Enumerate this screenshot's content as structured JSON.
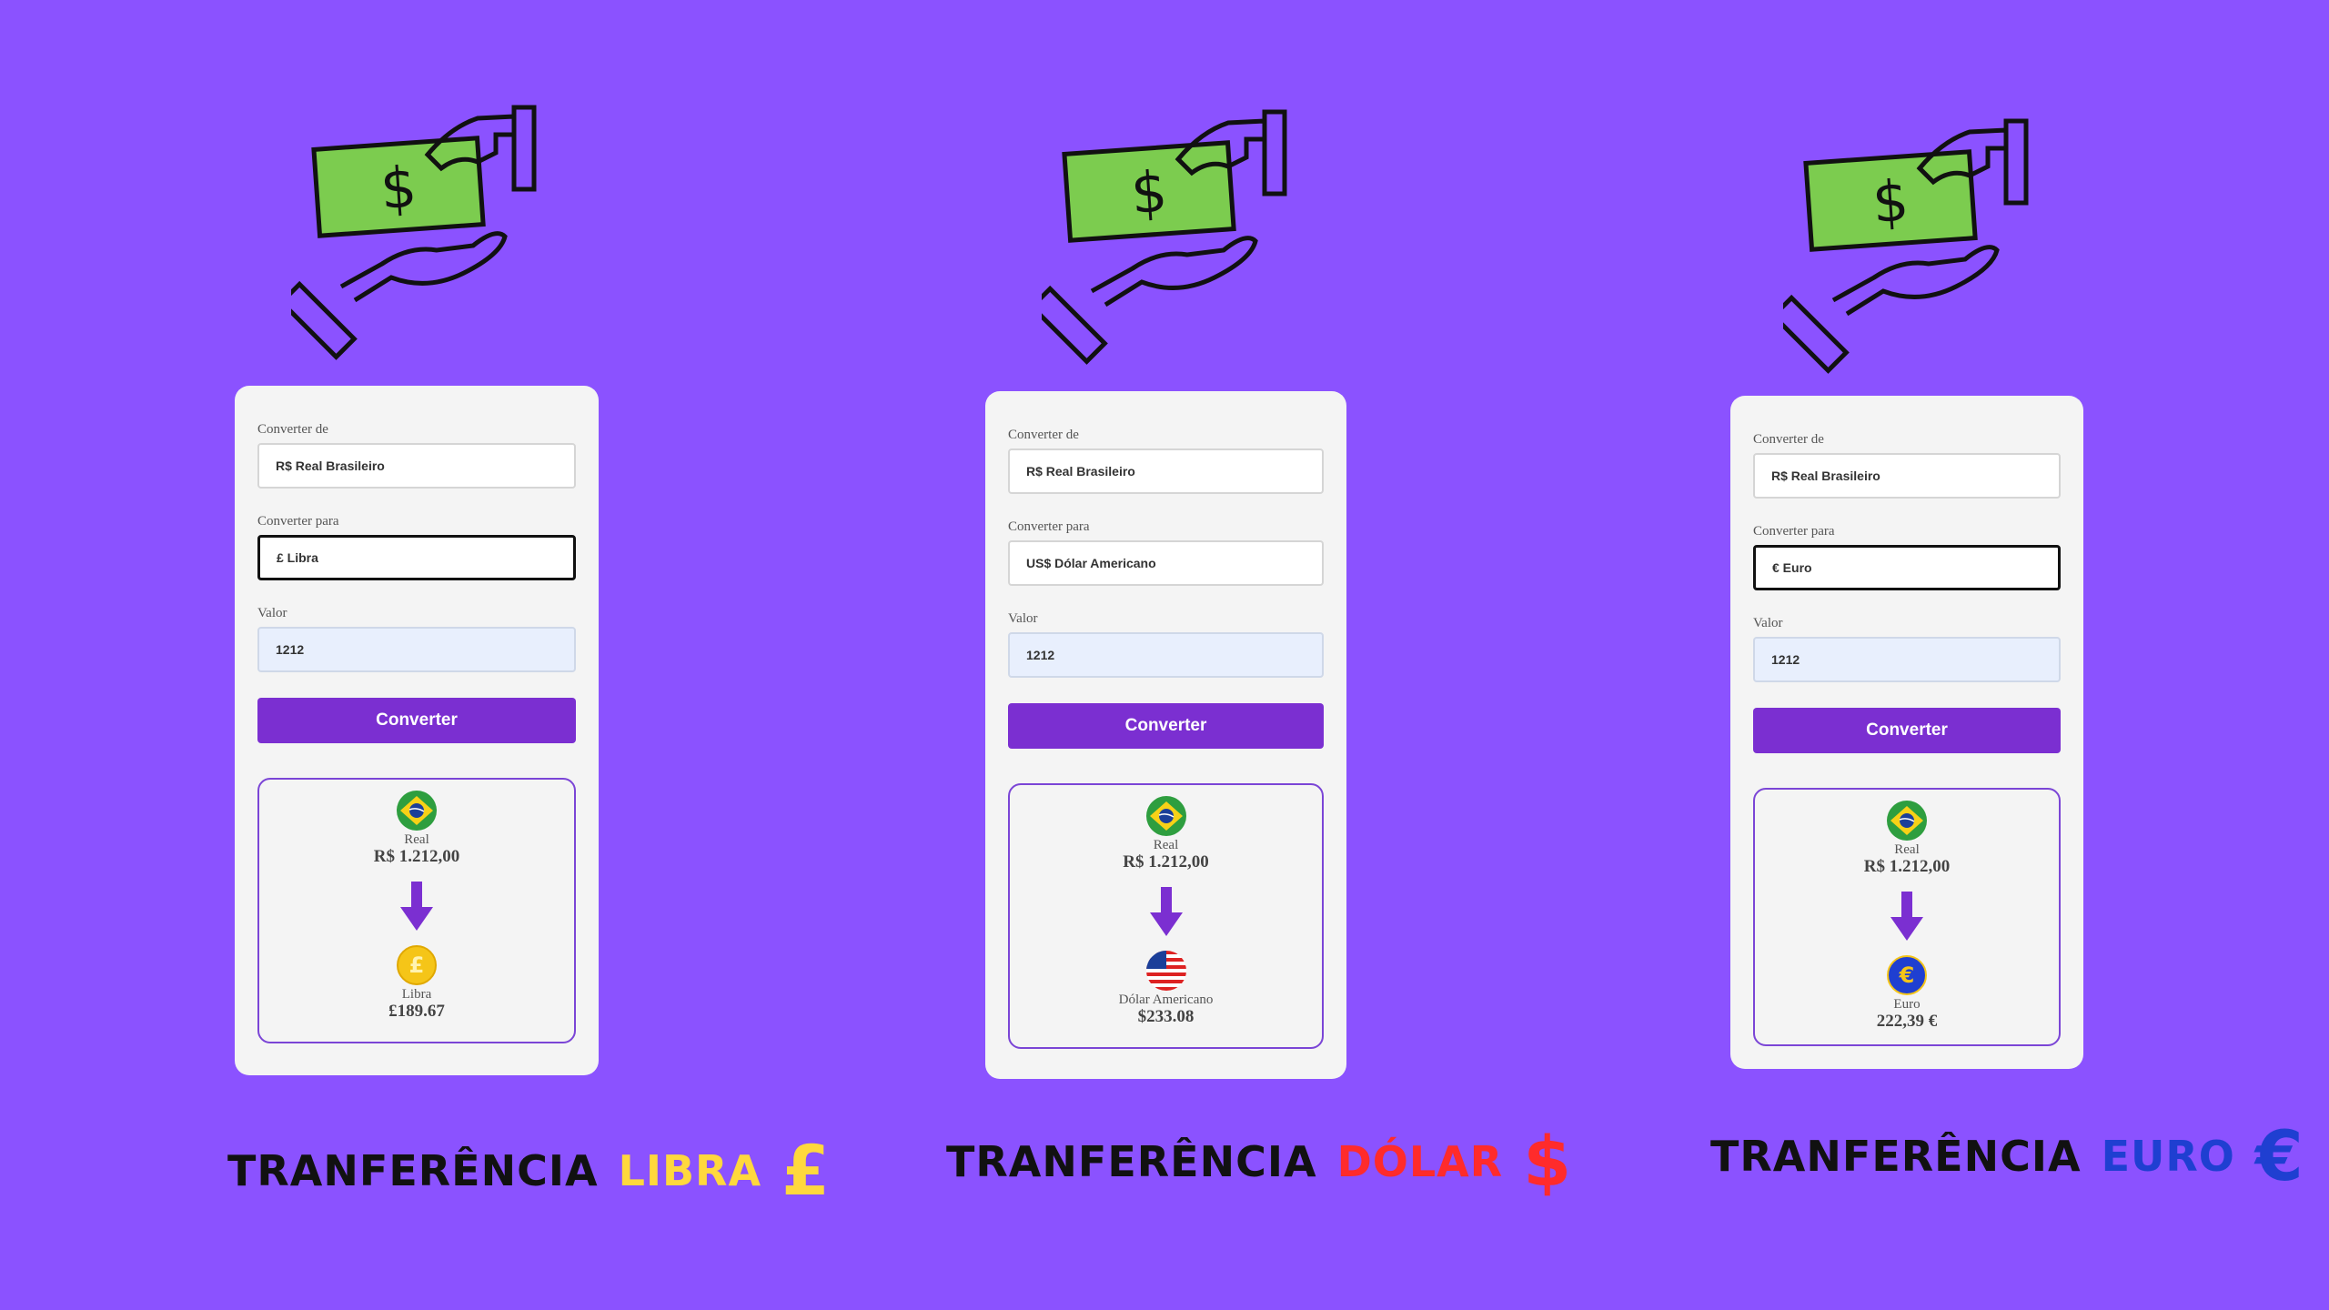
{
  "panels": [
    {
      "form": {
        "from_label": "Converter de",
        "from_value": "R$ Real Brasileiro",
        "to_label": "Converter para",
        "to_value": "£ Libra",
        "amount_label": "Valor",
        "amount_value": "1212",
        "button_label": "Converter"
      },
      "result": {
        "source_name": "Real",
        "source_amount": "R$ 1.212,00",
        "target_name": "Libra",
        "target_amount": "£189.67"
      },
      "caption": {
        "prefix": "TRANFERÊNCIA",
        "currency": "LIBRA",
        "symbol": "£",
        "color": "#ffd83d"
      }
    },
    {
      "form": {
        "from_label": "Converter de",
        "from_value": "R$ Real Brasileiro",
        "to_label": "Converter para",
        "to_value": "US$ Dólar Americano",
        "amount_label": "Valor",
        "amount_value": "1212",
        "button_label": "Converter"
      },
      "result": {
        "source_name": "Real",
        "source_amount": "R$ 1.212,00",
        "target_name": "Dólar Americano",
        "target_amount": "$233.08"
      },
      "caption": {
        "prefix": "TRANFERÊNCIA",
        "currency": "DÓLAR",
        "symbol": "$",
        "color": "#ff2b2b"
      }
    },
    {
      "form": {
        "from_label": "Converter de",
        "from_value": "R$ Real Brasileiro",
        "to_label": "Converter para",
        "to_value": "€ Euro",
        "amount_label": "Valor",
        "amount_value": "1212",
        "button_label": "Converter"
      },
      "result": {
        "source_name": "Real",
        "source_amount": "R$ 1.212,00",
        "target_name": "Euro",
        "target_amount": "222,39 €"
      },
      "caption": {
        "prefix": "TRANFERÊNCIA",
        "currency": "EURO",
        "symbol": "€",
        "color": "#1f3fd1"
      }
    }
  ],
  "colors": {
    "background": "#8b52ff",
    "button": "#7b2fd1",
    "bill": "#7ccc4f"
  },
  "icons": [
    "money-hand-icon",
    "brazil-flag-icon",
    "down-arrow-icon",
    "pound-coin-icon",
    "usa-flag-icon",
    "euro-coin-icon"
  ]
}
